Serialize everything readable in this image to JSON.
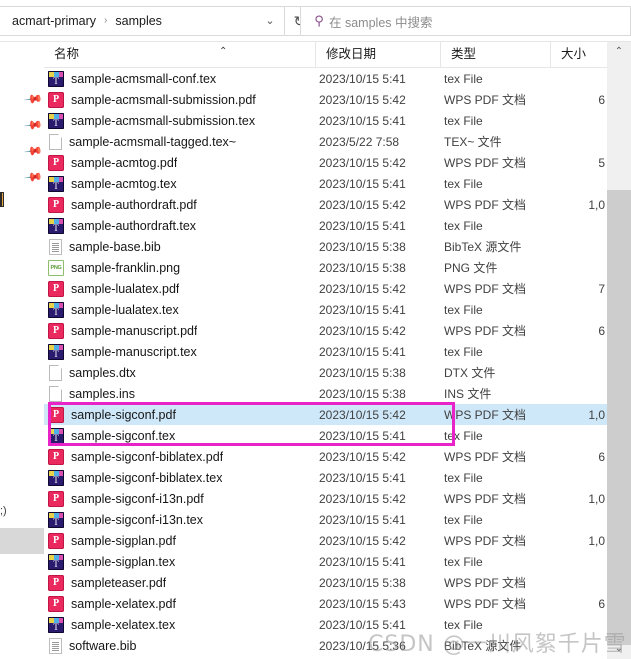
{
  "address_bar": {
    "back_chevron": "‹",
    "crumbs": [
      "acmart-primary",
      "samples"
    ],
    "separator": "›",
    "dropdown_icon": "⌄",
    "refresh_icon": "↻"
  },
  "search": {
    "icon": "⚲",
    "placeholder": "在 samples 中搜索"
  },
  "columns": {
    "name": "名称",
    "date_modified": "修改日期",
    "type": "类型",
    "size": "大小",
    "sort_arrow": "⌃"
  },
  "scrollbar": {
    "up_arrow": "⌃",
    "down_arrow": "⌄"
  },
  "watermark": "CSDN @一川风絮千片雪",
  "type_labels": {
    "tex": "tex File",
    "pdf": "WPS PDF 文档",
    "tex_backup": "TEX~ 文件",
    "bib": "BibTeX 源文件",
    "png": "PNG 文件",
    "dtx": "DTX 文件",
    "ins": "INS 文件"
  },
  "files": [
    {
      "name": "sample-acmsmall-conf.tex",
      "icon": "tex-file-icon",
      "date": "2023/10/15 5:41",
      "type": "tex File",
      "size": "",
      "selected": false
    },
    {
      "name": "sample-acmsmall-submission.pdf",
      "icon": "pdf-file-icon",
      "date": "2023/10/15 5:42",
      "type": "WPS PDF 文档",
      "size": "6",
      "selected": false
    },
    {
      "name": "sample-acmsmall-submission.tex",
      "icon": "tex-file-icon",
      "date": "2023/10/15 5:41",
      "type": "tex File",
      "size": "",
      "selected": false
    },
    {
      "name": "sample-acmsmall-tagged.tex~",
      "icon": "blank-file-icon",
      "date": "2023/5/22 7:58",
      "type": "TEX~ 文件",
      "size": "",
      "selected": false
    },
    {
      "name": "sample-acmtog.pdf",
      "icon": "pdf-file-icon",
      "date": "2023/10/15 5:42",
      "type": "WPS PDF 文档",
      "size": "5",
      "selected": false
    },
    {
      "name": "sample-acmtog.tex",
      "icon": "tex-file-icon",
      "date": "2023/10/15 5:41",
      "type": "tex File",
      "size": "",
      "selected": false
    },
    {
      "name": "sample-authordraft.pdf",
      "icon": "pdf-file-icon",
      "date": "2023/10/15 5:42",
      "type": "WPS PDF 文档",
      "size": "1,0",
      "selected": false
    },
    {
      "name": "sample-authordraft.tex",
      "icon": "tex-file-icon",
      "date": "2023/10/15 5:41",
      "type": "tex File",
      "size": "",
      "selected": false
    },
    {
      "name": "sample-base.bib",
      "icon": "bib-file-icon",
      "date": "2023/10/15 5:38",
      "type": "BibTeX 源文件",
      "size": "",
      "selected": false
    },
    {
      "name": "sample-franklin.png",
      "icon": "png-file-icon",
      "date": "2023/10/15 5:38",
      "type": "PNG 文件",
      "size": "",
      "selected": false
    },
    {
      "name": "sample-lualatex.pdf",
      "icon": "pdf-file-icon",
      "date": "2023/10/15 5:42",
      "type": "WPS PDF 文档",
      "size": "7",
      "selected": false
    },
    {
      "name": "sample-lualatex.tex",
      "icon": "tex-file-icon",
      "date": "2023/10/15 5:41",
      "type": "tex File",
      "size": "",
      "selected": false
    },
    {
      "name": "sample-manuscript.pdf",
      "icon": "pdf-file-icon",
      "date": "2023/10/15 5:42",
      "type": "WPS PDF 文档",
      "size": "6",
      "selected": false
    },
    {
      "name": "sample-manuscript.tex",
      "icon": "tex-file-icon",
      "date": "2023/10/15 5:41",
      "type": "tex File",
      "size": "",
      "selected": false
    },
    {
      "name": "samples.dtx",
      "icon": "blank-file-icon",
      "date": "2023/10/15 5:38",
      "type": "DTX 文件",
      "size": "",
      "selected": false
    },
    {
      "name": "samples.ins",
      "icon": "blank-file-icon",
      "date": "2023/10/15 5:38",
      "type": "INS 文件",
      "size": "",
      "selected": false
    },
    {
      "name": "sample-sigconf.pdf",
      "icon": "pdf-file-icon",
      "date": "2023/10/15 5:42",
      "type": "WPS PDF 文档",
      "size": "1,0",
      "selected": true
    },
    {
      "name": "sample-sigconf.tex",
      "icon": "tex-file-icon",
      "date": "2023/10/15 5:41",
      "type": "tex File",
      "size": "",
      "selected": false
    },
    {
      "name": "sample-sigconf-biblatex.pdf",
      "icon": "pdf-file-icon",
      "date": "2023/10/15 5:42",
      "type": "WPS PDF 文档",
      "size": "6",
      "selected": false
    },
    {
      "name": "sample-sigconf-biblatex.tex",
      "icon": "tex-file-icon",
      "date": "2023/10/15 5:41",
      "type": "tex File",
      "size": "",
      "selected": false
    },
    {
      "name": "sample-sigconf-i13n.pdf",
      "icon": "pdf-file-icon",
      "date": "2023/10/15 5:42",
      "type": "WPS PDF 文档",
      "size": "1,0",
      "selected": false
    },
    {
      "name": "sample-sigconf-i13n.tex",
      "icon": "tex-file-icon",
      "date": "2023/10/15 5:41",
      "type": "tex File",
      "size": "",
      "selected": false
    },
    {
      "name": "sample-sigplan.pdf",
      "icon": "pdf-file-icon",
      "date": "2023/10/15 5:42",
      "type": "WPS PDF 文档",
      "size": "1,0",
      "selected": false
    },
    {
      "name": "sample-sigplan.tex",
      "icon": "tex-file-icon",
      "date": "2023/10/15 5:41",
      "type": "tex File",
      "size": "",
      "selected": false
    },
    {
      "name": "sampleteaser.pdf",
      "icon": "pdf-file-icon",
      "date": "2023/10/15 5:38",
      "type": "WPS PDF 文档",
      "size": "",
      "selected": false
    },
    {
      "name": "sample-xelatex.pdf",
      "icon": "pdf-file-icon",
      "date": "2023/10/15 5:43",
      "type": "WPS PDF 文档",
      "size": "6",
      "selected": false
    },
    {
      "name": "sample-xelatex.tex",
      "icon": "tex-file-icon",
      "date": "2023/10/15 5:41",
      "type": "tex File",
      "size": "",
      "selected": false
    },
    {
      "name": "software.bib",
      "icon": "bib-file-icon",
      "date": "2023/10/15 5:36",
      "type": "BibTeX 源文件",
      "size": "",
      "selected": false
    }
  ]
}
